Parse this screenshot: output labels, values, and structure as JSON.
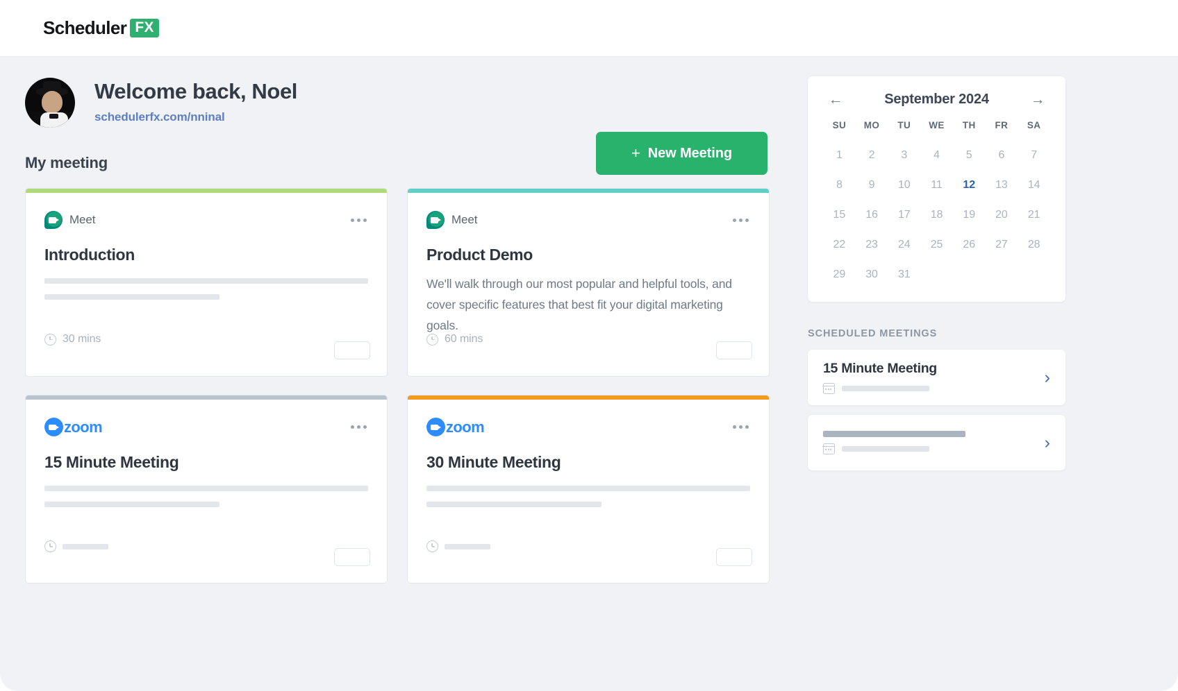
{
  "brand": {
    "name": "Scheduler",
    "badge": "FX"
  },
  "welcome": {
    "title": "Welcome back, Noel",
    "link": "schedulerfx.com/nninal",
    "avatar_icon": "user-avatar-photo"
  },
  "actions": {
    "new_meeting": "New Meeting",
    "plus": "+"
  },
  "main": {
    "section_title": "My meeting",
    "cards": [
      {
        "provider": "Meet",
        "provider_icon": "google-meet-icon",
        "title": "Introduction",
        "description": "",
        "duration": "30 mins",
        "stripe": "#adda7a",
        "has_skeleton": true,
        "has_duration_skeleton": false
      },
      {
        "provider": "Meet",
        "provider_icon": "google-meet-icon",
        "title": "Product Demo",
        "description": "We'll walk through our most popular and helpful tools, and cover specific features that best fit your digital marketing goals.",
        "duration": "60 mins",
        "stripe": "#5ecfc9",
        "has_skeleton": false,
        "has_duration_skeleton": false
      },
      {
        "provider": "zoom",
        "provider_icon": "zoom-icon",
        "title": "15 Minute Meeting",
        "description": "",
        "duration": "",
        "stripe": "#b9c3cd",
        "has_skeleton": true,
        "has_duration_skeleton": true
      },
      {
        "provider": "zoom",
        "provider_icon": "zoom-icon",
        "title": "30 Minute Meeting",
        "description": "",
        "duration": "",
        "stripe": "#f59a20",
        "has_skeleton": true,
        "has_duration_skeleton": true
      }
    ]
  },
  "calendar": {
    "month_label": "September 2024",
    "prev_icon": "arrow-left-icon",
    "next_icon": "arrow-right-icon",
    "prev_glyph": "←",
    "next_glyph": "→",
    "weekdays": [
      "SU",
      "MO",
      "TU",
      "WE",
      "TH",
      "FR",
      "SA"
    ],
    "lead_blanks": 0,
    "days": [
      1,
      2,
      3,
      4,
      5,
      6,
      7,
      8,
      9,
      10,
      11,
      12,
      13,
      14,
      15,
      16,
      17,
      18,
      19,
      20,
      21,
      22,
      23,
      24,
      25,
      26,
      27,
      28,
      29,
      30,
      31
    ],
    "today": 12,
    "today_color": "#2e5fad"
  },
  "scheduled": {
    "label": "SCHEDULED MEETINGS",
    "items": [
      {
        "title": "15 Minute Meeting",
        "title_is_skeleton": false,
        "calendar_icon": "calendar-icon",
        "chevron_icon": "chevron-right-icon",
        "chevron_glyph": "›"
      },
      {
        "title": "",
        "title_is_skeleton": true,
        "calendar_icon": "calendar-icon",
        "chevron_icon": "chevron-right-icon",
        "chevron_glyph": "›"
      }
    ]
  },
  "theme": {
    "accent_green": "#28b26c",
    "link_blue": "#5b7ec4",
    "page_bg": "#f1f2f6",
    "zoom_blue": "#2d8cff",
    "meet_green": "#1aa37a"
  }
}
